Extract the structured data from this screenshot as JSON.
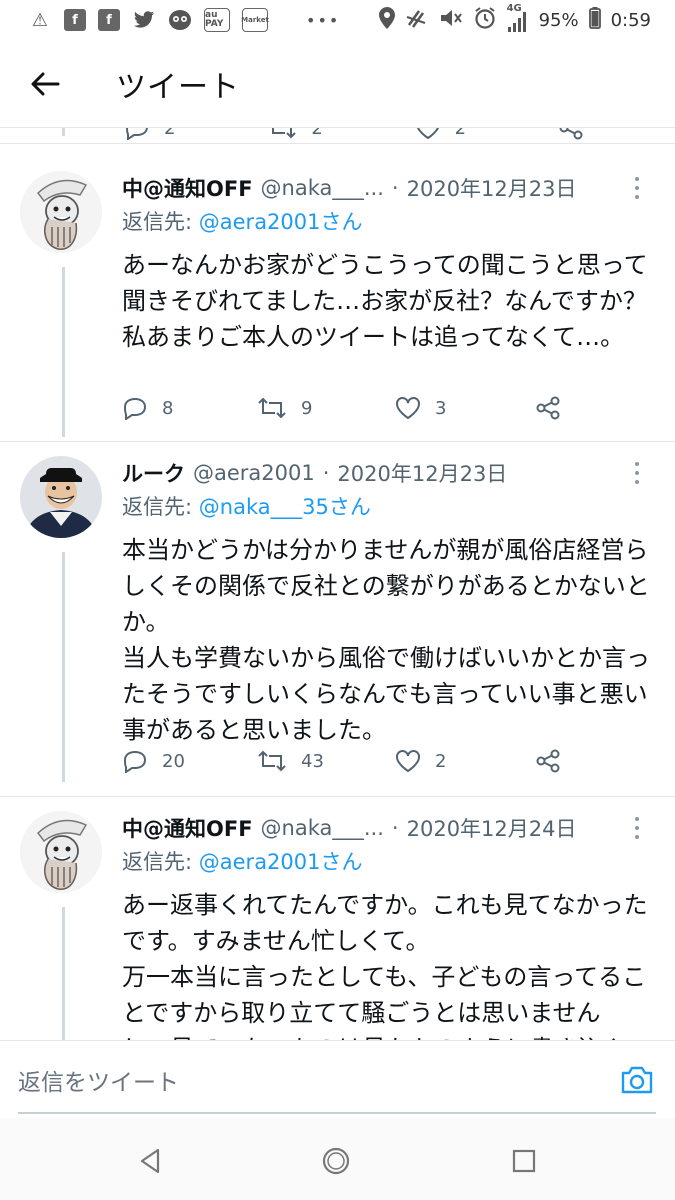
{
  "status_bar": {
    "network": "4G",
    "battery": "95%",
    "time": "0:59",
    "more": "•••",
    "au_pay_label": "au PAY",
    "market_label": "Market",
    "icons": [
      "warning-icon",
      "facebook-icon",
      "facebook-icon",
      "twitter-icon",
      "app-icon",
      "au-pay-icon",
      "market-icon",
      "location-icon",
      "nfc-icon",
      "mute-icon",
      "alarm-icon",
      "signal-icon",
      "battery-icon"
    ]
  },
  "header": {
    "title": "ツイート"
  },
  "previous_tweet_actions": {
    "replies": "2",
    "retweets": "2",
    "likes": "2"
  },
  "tweets": [
    {
      "name": "中@通知OFF",
      "handle": "@naka___...",
      "dot": "·",
      "date": "2020年12月23日",
      "reply_prefix": "返信先: ",
      "reply_to": "@aera2001さん",
      "text": "あーなんかお家がどうこうっての聞こうと思って聞きそびれてました…お家が反社？なんですか？私あまりご本人のツイートは追ってなくて…。",
      "replies": "8",
      "retweets": "9",
      "likes": "3"
    },
    {
      "name": "ルーク",
      "handle": "@aera2001",
      "dot": "·",
      "date": "2020年12月23日",
      "reply_prefix": "返信先: ",
      "reply_to": "@naka___35さん",
      "text": "本当かどうかは分かりませんが親が風俗店経営らしくその関係で反社との繋がりがあるとかないとか。\n当人も学費ないから風俗で働けばいいかとか言ったそうですしいくらなんでも言っていい事と悪い事があると思いました。",
      "replies": "20",
      "retweets": "43",
      "likes": "2"
    },
    {
      "name": "中@通知OFF",
      "handle": "@naka___...",
      "dot": "·",
      "date": "2020年12月24日",
      "reply_prefix": "返信先: ",
      "reply_to": "@aera2001さん",
      "text": "あー返事くれてたんですか。これも見てなかったです。すみません忙しくて。\n万一本当に言ったとしても、子どもの言ってることですから取り立てて騒ごうとは思いません し、見ていないものは見たかのように書き込ん"
    }
  ],
  "composer": {
    "placeholder": "返信をツイート"
  }
}
